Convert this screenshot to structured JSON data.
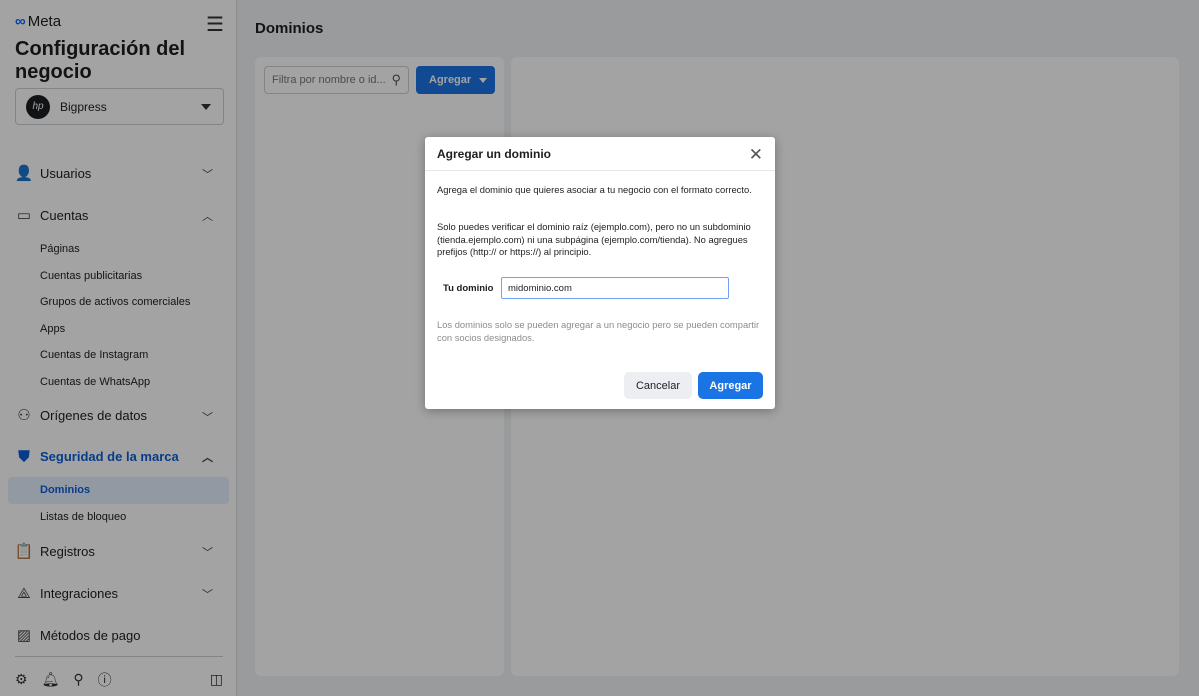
{
  "sidebar": {
    "logo": "Meta",
    "title": "Configuración del negocio",
    "business": {
      "name": "Bigpress",
      "avatar": "hp"
    },
    "sections": [
      {
        "label": "Usuarios",
        "icon": "users-icon",
        "expanded": false
      },
      {
        "label": "Cuentas",
        "icon": "accounts-icon",
        "expanded": true,
        "items": [
          "Páginas",
          "Cuentas publicitarias",
          "Grupos de activos comerciales",
          "Apps",
          "Cuentas de Instagram",
          "Cuentas de WhatsApp"
        ]
      },
      {
        "label": "Orígenes de datos",
        "icon": "data-sources-icon",
        "expanded": false
      },
      {
        "label": "Seguridad de la marca",
        "icon": "shield-icon",
        "expanded": true,
        "active": true,
        "items": [
          "Dominios",
          "Listas de bloqueo"
        ]
      },
      {
        "label": "Registros",
        "icon": "clipboard-icon",
        "expanded": false
      },
      {
        "label": "Integraciones",
        "icon": "integrations-icon",
        "expanded": false
      },
      {
        "label": "Métodos de pago",
        "icon": "credit-card-icon"
      }
    ],
    "active_item": "Dominios"
  },
  "main": {
    "title": "Dominios",
    "filter_placeholder": "Filtra por nombre o id...",
    "add_label": "Agregar"
  },
  "modal": {
    "title": "Agregar un dominio",
    "p1": "Agrega el dominio que quieres asociar a tu negocio con el formato correcto.",
    "p2": "Solo puedes verificar el dominio raíz (ejemplo.com), pero no un subdominio (tienda.ejemplo.com) ni una subpágina (ejemplo.com/tienda). No agregues prefijos (http:// or https://) al principio.",
    "field_label": "Tu dominio",
    "field_value": "midominio.com",
    "note": "Los dominios solo se pueden agregar a un negocio pero se pueden compartir con socios designados.",
    "cancel": "Cancelar",
    "submit": "Agregar"
  },
  "colors": {
    "accent": "#1b74e4"
  }
}
